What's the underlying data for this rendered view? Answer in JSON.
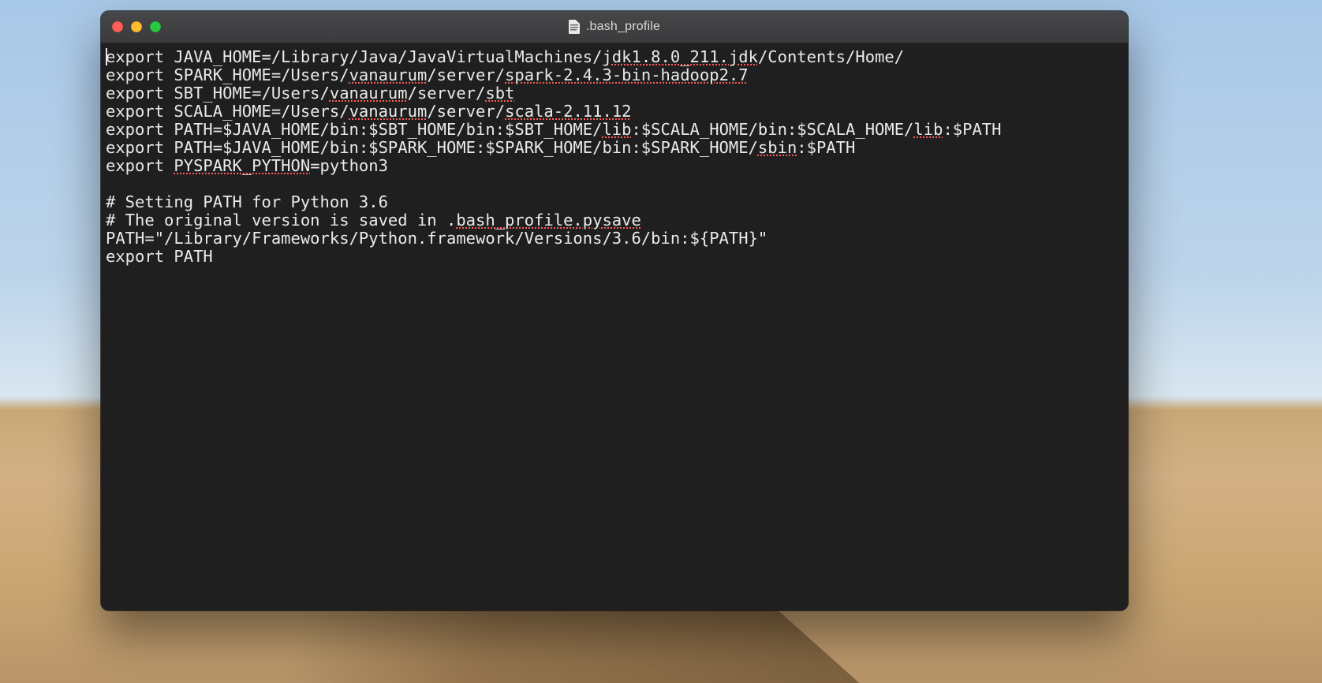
{
  "window": {
    "title": ".bash_profile"
  },
  "file": {
    "lines": [
      "export JAVA_HOME=/Library/Java/JavaVirtualMachines/jdk1.8.0_211.jdk/Contents/Home/",
      "export SPARK_HOME=/Users/vanaurum/server/spark-2.4.3-bin-hadoop2.7",
      "export SBT_HOME=/Users/vanaurum/server/sbt",
      "export SCALA_HOME=/Users/vanaurum/server/scala-2.11.12",
      "export PATH=$JAVA_HOME/bin:$SBT_HOME/bin:$SBT_HOME/lib:$SCALA_HOME/bin:$SCALA_HOME/lib:$PATH",
      "export PATH=$JAVA_HOME/bin:$SPARK_HOME:$SPARK_HOME/bin:$SPARK_HOME/sbin:$PATH",
      "export PYSPARK_PYTHON=python3",
      "",
      "# Setting PATH for Python 3.6",
      "# The original version is saved in .bash_profile.pysave",
      "PATH=\"/Library/Frameworks/Python.framework/Versions/3.6/bin:${PATH}\"",
      "export PATH"
    ],
    "spellcheck_tokens": [
      "jdk1.8.0_211.jdk",
      "vanaurum",
      "spark-2.4.3-bin-hadoop2.7",
      "sbt",
      "scala-2.11.12",
      "lib",
      "sbin",
      "PYSPARK_PYTHON",
      "bash_profile.pysave"
    ]
  },
  "colors": {
    "window_bg": "#1f1f1f",
    "titlebar_bg": "#3f3f41",
    "text": "#eaeaea",
    "spell_underline": "#ff5a5a",
    "traffic_red": "#ff5f57",
    "traffic_yellow": "#ffbd2e",
    "traffic_green": "#28c840"
  }
}
